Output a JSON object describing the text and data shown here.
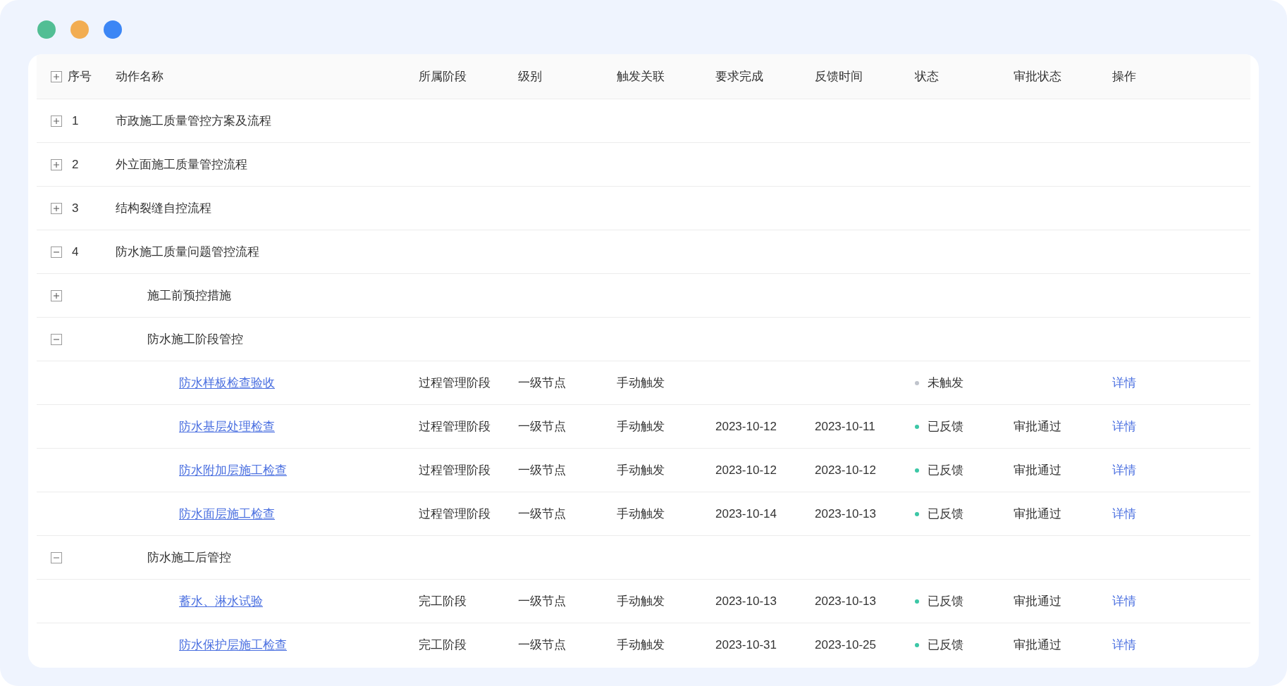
{
  "window": {
    "controls": [
      {
        "color": "#52be94"
      },
      {
        "color": "#f2ad52"
      },
      {
        "color": "#3c86f5"
      }
    ]
  },
  "table": {
    "expanded": false,
    "columns": [
      "序号",
      "动作名称",
      "所属阶段",
      "级别",
      "触发关联",
      "要求完成",
      "反馈时间",
      "状态",
      "审批状态",
      "操作"
    ],
    "rows": [
      {
        "index": "1",
        "name": "市政施工质量管控方案及流程",
        "expanded": false
      },
      {
        "index": "2",
        "name": "外立面施工质量管控流程",
        "expanded": false
      },
      {
        "index": "3",
        "name": "结构裂缝自控流程",
        "expanded": false
      },
      {
        "index": "4",
        "name": "防水施工质量问题管控流程",
        "expanded": true,
        "children": [
          {
            "name": "施工前预控措施",
            "expanded": false
          },
          {
            "name": "防水施工阶段管控",
            "expanded": true,
            "children": [
              {
                "name": "防水样板检查验收",
                "stage": "过程管理阶段",
                "level_label": "一级节点",
                "trigger": "手动触发",
                "status": "未触发",
                "color": "#c0c4cc",
                "action": "详情"
              },
              {
                "name": "防水基层处理检查",
                "stage": "过程管理阶段",
                "level_label": "一级节点",
                "trigger": "手动触发",
                "required": "2023-10-12",
                "feedback": "2023-10-11",
                "status": "已反馈",
                "color": "#3cc7a6",
                "approval": "审批通过",
                "action": "详情"
              },
              {
                "name": "防水附加层施工检查",
                "stage": "过程管理阶段",
                "level_label": "一级节点",
                "trigger": "手动触发",
                "required": "2023-10-12",
                "feedback": "2023-10-12",
                "status": "已反馈",
                "color": "#3cc7a6",
                "approval": "审批通过",
                "action": "详情"
              },
              {
                "name": "防水面层施工检查",
                "stage": "过程管理阶段",
                "level_label": "一级节点",
                "trigger": "手动触发",
                "required": "2023-10-14",
                "feedback": "2023-10-13",
                "status": "已反馈",
                "color": "#3cc7a6",
                "approval": "审批通过",
                "action": "详情"
              }
            ]
          },
          {
            "name": "防水施工后管控",
            "expanded": true,
            "children": [
              {
                "name": "蓄水、淋水试验",
                "stage": "完工阶段",
                "level_label": "一级节点",
                "trigger": "手动触发",
                "required": "2023-10-13",
                "feedback": "2023-10-13",
                "status": "已反馈",
                "color": "#3cc7a6",
                "approval": "审批通过",
                "action": "详情"
              },
              {
                "name": "防水保护层施工检查",
                "stage": "完工阶段",
                "level_label": "一级节点",
                "trigger": "手动触发",
                "required": "2023-10-31",
                "feedback": "2023-10-25",
                "status": "已反馈",
                "color": "#3cc7a6",
                "approval": "审批通过",
                "action": "详情"
              }
            ]
          }
        ]
      }
    ]
  }
}
